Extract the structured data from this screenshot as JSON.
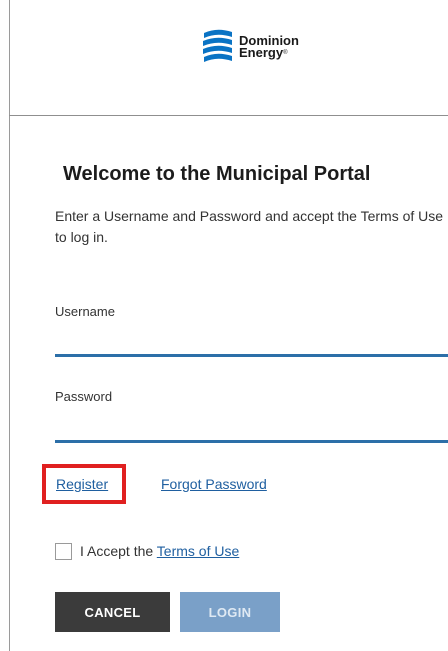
{
  "brand": {
    "line1": "Dominion",
    "line2": "Energy",
    "trademark": "®",
    "accent": "#0a73c4"
  },
  "portal": {
    "title": "Welcome to the Municipal Portal",
    "intro": "Enter a Username and Password and accept the Terms of Use to log in."
  },
  "form": {
    "username_label": "Username",
    "username_value": "",
    "password_label": "Password",
    "password_value": "",
    "field_underline_color": "#2c6fa8"
  },
  "links": {
    "register": "Register",
    "forgot_password": "Forgot Password"
  },
  "terms": {
    "prefix": "I Accept the ",
    "link": "Terms of Use",
    "checked": false
  },
  "buttons": {
    "cancel": "CANCEL",
    "login": "LOGIN",
    "login_disabled": true
  },
  "highlight": {
    "target": "register",
    "color": "#e02020"
  }
}
